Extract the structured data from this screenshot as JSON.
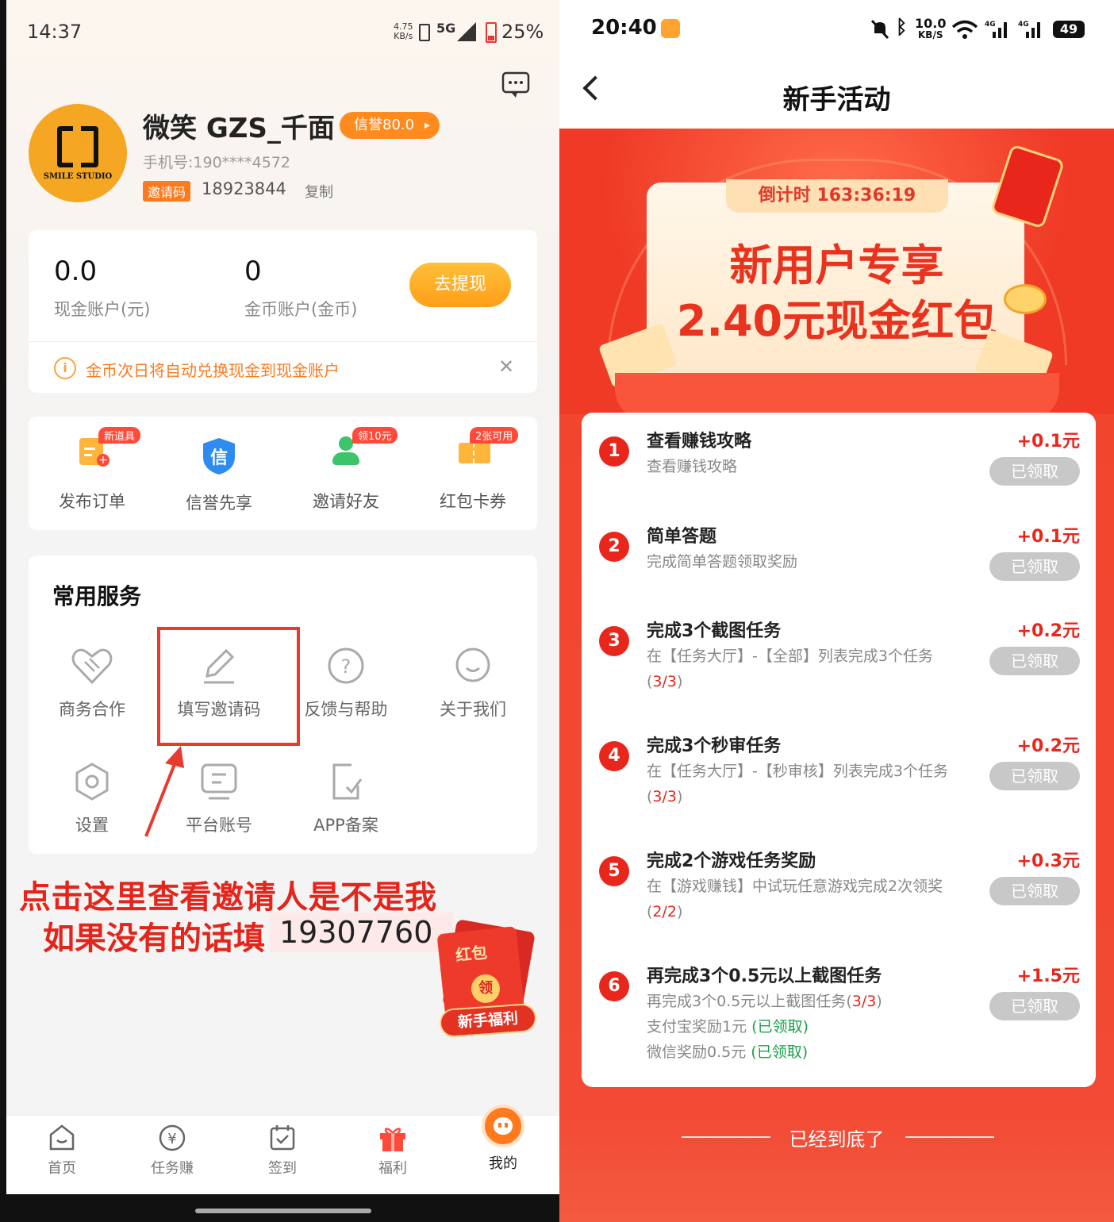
{
  "left": {
    "status": {
      "time": "14:37",
      "speed_value": "4.75",
      "speed_unit": "KB/s",
      "network": "5G",
      "battery": "25%"
    },
    "profile": {
      "avatar_text": "SMILE STUDIO",
      "name": "微笑 GZS_千面",
      "credit": "信誉80.0",
      "phone": "手机号:190****4572",
      "invite_tag": "邀请码",
      "invite_code": "18923844",
      "copy": "复制"
    },
    "balance": {
      "cash_value": "0.0",
      "cash_label": "现金账户(元)",
      "coin_value": "0",
      "coin_label": "金币账户(金币)",
      "withdraw": "去提现",
      "notice": "金币次日将自动兑换现金到现金账户"
    },
    "tools": [
      {
        "label": "发布订单",
        "badge": "新道具"
      },
      {
        "label": "信誉先享",
        "badge": ""
      },
      {
        "label": "邀请好友",
        "badge": "领10元"
      },
      {
        "label": "红包卡券",
        "badge": "2张可用"
      }
    ],
    "services": {
      "title": "常用服务",
      "items": [
        "商务合作",
        "填写邀请码",
        "反馈与帮助",
        "关于我们",
        "设置",
        "平台账号",
        "APP备案"
      ]
    },
    "annotation": {
      "line1": "点击这里查看邀请人是不是我",
      "line2": "如果没有的话填",
      "number": "19307760"
    },
    "float_redpacket": {
      "top": "红包",
      "center": "领",
      "bottom": "新手福利"
    },
    "tabs": [
      "首页",
      "任务赚",
      "签到",
      "福利",
      "我的"
    ]
  },
  "right": {
    "status": {
      "time": "20:40",
      "speed_value": "10.0",
      "speed_unit": "KB/S",
      "battery": "49"
    },
    "title": "新手活动",
    "countdown": "倒计时 163:36:19",
    "promo_line1": "新用户专享",
    "promo_line2": "2.40元现金红包",
    "tasks": [
      {
        "num": "1",
        "title": "查看赚钱攻略",
        "reward": "+0.1元",
        "desc": "查看赚钱攻略",
        "button": "已领取"
      },
      {
        "num": "2",
        "title": "简单答题",
        "reward": "+0.1元",
        "desc": "完成简单答题领取奖励",
        "button": "已领取"
      },
      {
        "num": "3",
        "title": "完成3个截图任务",
        "reward": "+0.2元",
        "desc": "在【任务大厅】-【全部】列表完成3个任务",
        "progress": "3/3",
        "button": "已领取"
      },
      {
        "num": "4",
        "title": "完成3个秒审任务",
        "reward": "+0.2元",
        "desc": "在【任务大厅】-【秒审核】列表完成3个任务",
        "progress": "3/3",
        "button": "已领取"
      },
      {
        "num": "5",
        "title": "完成2个游戏任务奖励",
        "reward": "+0.3元",
        "desc": "在【游戏赚钱】中试玩任意游戏完成2次领奖",
        "progress": "2/2",
        "button": "已领取"
      },
      {
        "num": "6",
        "title": "再完成3个0.5元以上截图任务",
        "reward": "+1.5元",
        "desc": "再完成3个0.5元以上截图任务",
        "progress": "3/3",
        "extra1_text": "支付宝奖励1元",
        "extra1_status": "已领取",
        "extra2_text": "微信奖励0.5元",
        "extra2_status": "已领取",
        "button": "已领取"
      }
    ],
    "bottom_text": "已经到底了"
  }
}
